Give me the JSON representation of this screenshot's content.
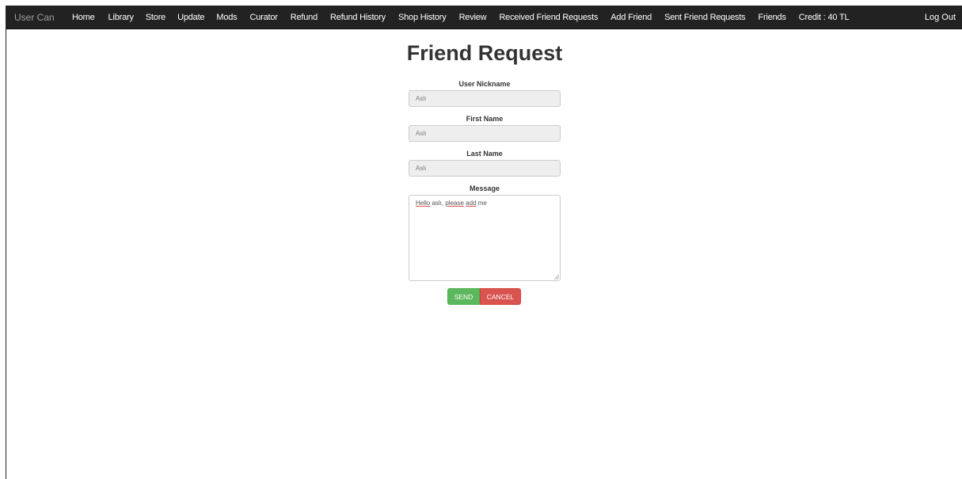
{
  "navbar": {
    "brand": "User Can",
    "items": [
      {
        "label": "Home"
      },
      {
        "label": "Library"
      },
      {
        "label": "Store"
      },
      {
        "label": "Update"
      },
      {
        "label": "Mods"
      },
      {
        "label": "Curator"
      },
      {
        "label": "Refund"
      },
      {
        "label": "Refund History"
      },
      {
        "label": "Shop History"
      },
      {
        "label": "Review"
      },
      {
        "label": "Received Friend Requests"
      },
      {
        "label": "Add Friend"
      },
      {
        "label": "Sent Friend Requests"
      },
      {
        "label": "Friends"
      },
      {
        "label": "Credit : 40 TL"
      }
    ],
    "logout": "Log Out"
  },
  "page": {
    "title": "Friend Request"
  },
  "form": {
    "nickname_label": "User Nickname",
    "nickname_value": "Aslı",
    "first_name_label": "First Name",
    "first_name_value": "Aslı",
    "last_name_label": "Last Name",
    "last_name_value": "Aslı",
    "message_label": "Message",
    "message_words": [
      "Hello",
      " aslı, ",
      "please",
      " ",
      "add",
      " me"
    ],
    "send_label": "SEND",
    "cancel_label": "CANCEL"
  },
  "colors": {
    "navbar_bg": "#222222",
    "brand_text": "#9d9d9d",
    "send": "#5cb85c",
    "cancel": "#d9534f"
  }
}
